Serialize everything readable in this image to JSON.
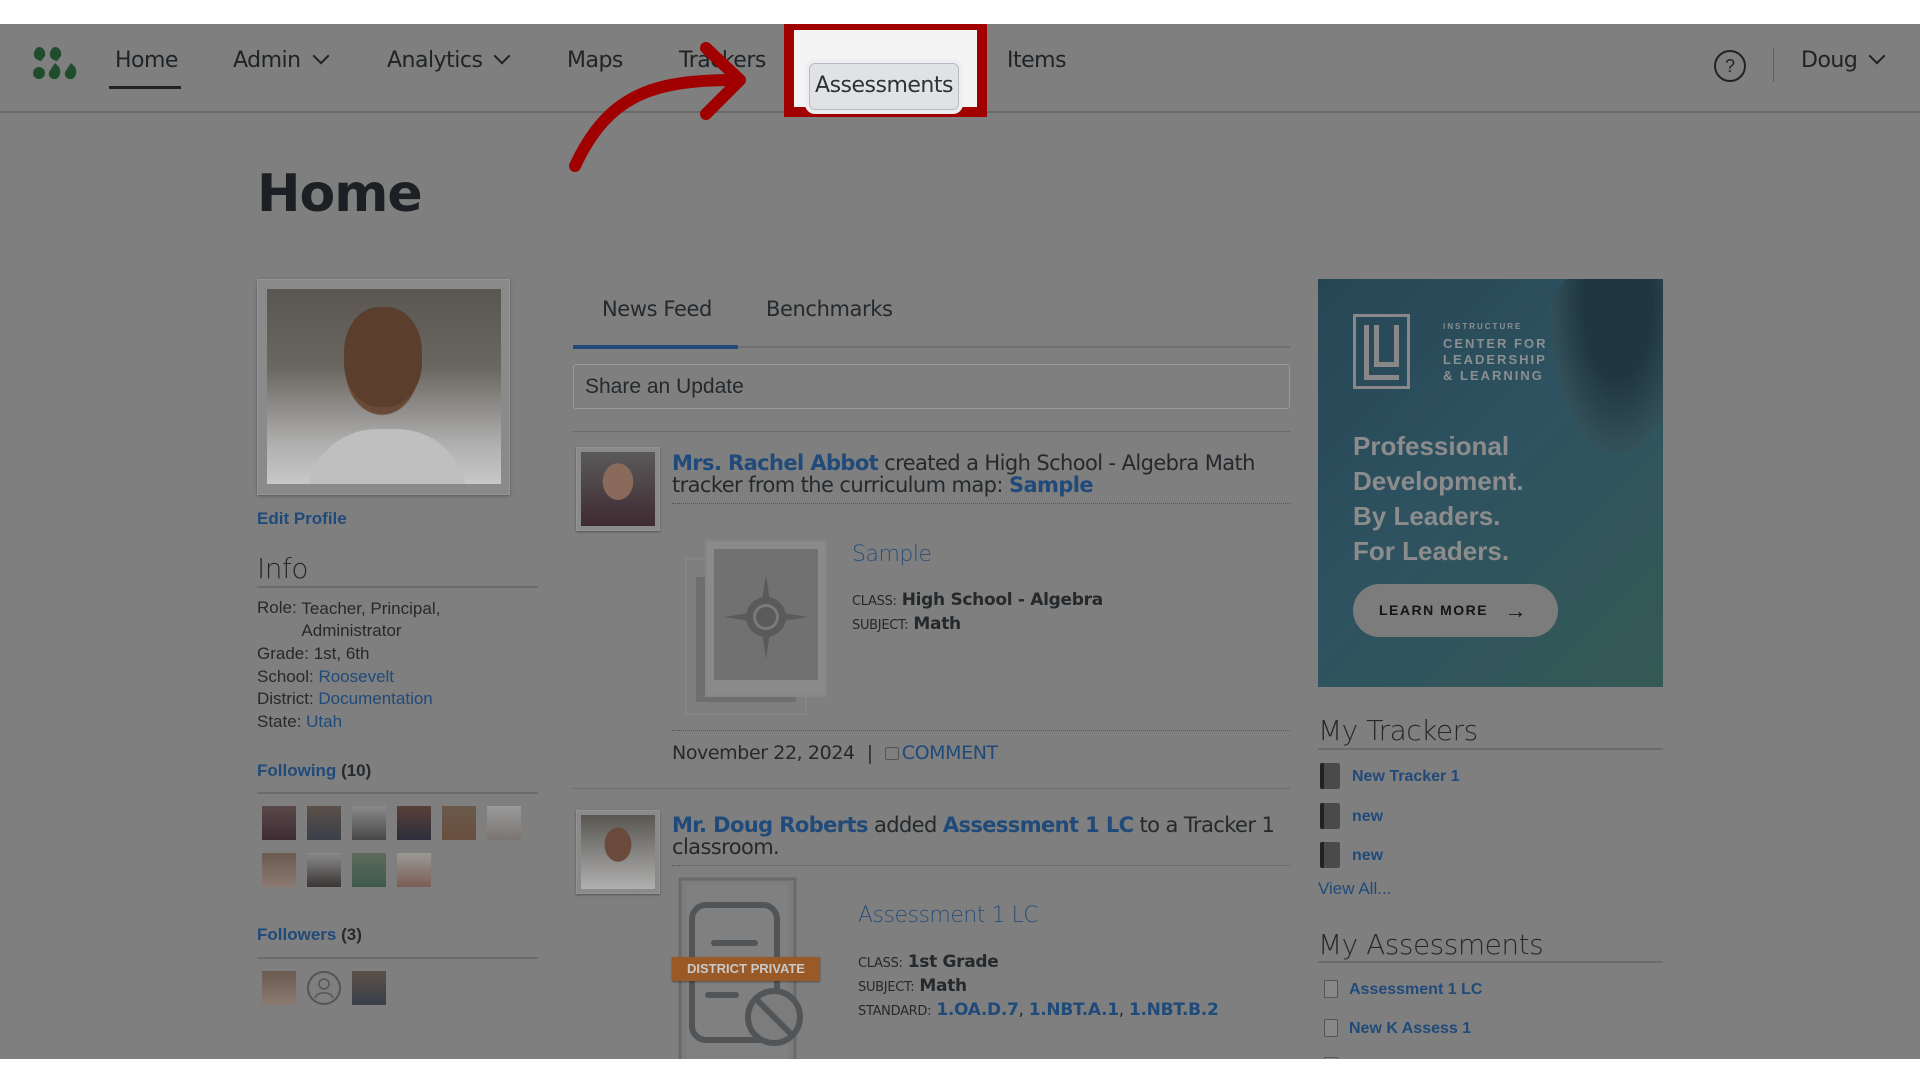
{
  "header": {
    "logo": "mastery-connect-logo",
    "nav": [
      {
        "label": "Home",
        "active": true,
        "dropdown": false
      },
      {
        "label": "Admin",
        "dropdown": true
      },
      {
        "label": "Analytics",
        "dropdown": true
      },
      {
        "label": "Maps",
        "dropdown": false
      },
      {
        "label": "Trackers",
        "dropdown": false
      },
      {
        "label": "Assessments",
        "dropdown": false,
        "highlighted": true
      },
      {
        "label": "Items",
        "dropdown": false
      }
    ],
    "help_icon": "?",
    "user_label": "Doug"
  },
  "annotation": {
    "color": "#a00000",
    "target": "Assessments"
  },
  "page": {
    "title": "Home"
  },
  "profile": {
    "edit_label": "Edit Profile",
    "info_heading": "Info",
    "role_label": "Role:",
    "role_value": "Teacher, Principal, Administrator",
    "grade_label": "Grade:",
    "grade_value": "1st, 6th",
    "school_label": "School:",
    "school_value": "Roosevelt",
    "district_label": "District:",
    "district_value": "Documentation",
    "state_label": "State:",
    "state_value": "Utah",
    "following_label": "Following",
    "following_count": "(10)",
    "followers_label": "Followers",
    "followers_count": "(3)"
  },
  "tabs": [
    {
      "label": "News Feed",
      "active": true
    },
    {
      "label": "Benchmarks",
      "active": false
    }
  ],
  "share": {
    "placeholder": "Share an Update"
  },
  "feed": [
    {
      "actor": "Mrs. Rachel Abbot",
      "text_1": " created a High School - Algebra Math tracker from the curriculum map: ",
      "link": "Sample",
      "card": {
        "title": "Sample",
        "class_label": "Class:",
        "class_value": "High School - Algebra",
        "subject_label": "Subject:",
        "subject_value": "Math"
      },
      "date": "November 22, 2024",
      "separator": "|",
      "comment_label": "COMMENT"
    },
    {
      "actor": "Mr. Doug Roberts",
      "text_1": " added ",
      "link": "Assessment 1 LC",
      "text_2": " to a Tracker 1 classroom.",
      "card": {
        "title": "Assessment 1 LC",
        "badge": "DISTRICT PRIVATE",
        "class_label": "Class:",
        "class_value": "1st Grade",
        "subject_label": "Subject:",
        "subject_value": "Math",
        "standard_label": "Standard:",
        "standards": [
          "1.OA.D.7",
          "1.NBT.A.1",
          "1.NBT.B.2"
        ]
      }
    }
  ],
  "ad": {
    "org_small": "INSTRUCTURE",
    "org_line1": "CENTER FOR",
    "org_line2": "LEADERSHIP",
    "org_line3": "& LEARNING",
    "headline_1": "Professional",
    "headline_2": "Development.",
    "headline_3": "By Leaders.",
    "headline_4": "For Leaders.",
    "button_label": "LEARN MORE",
    "button_arrow": "→"
  },
  "my_trackers": {
    "heading": "My Trackers",
    "items": [
      "New Tracker 1",
      "new",
      "new"
    ],
    "view_all": "View All..."
  },
  "my_assessments": {
    "heading": "My Assessments",
    "items": [
      "Assessment 1 LC",
      "New K Assess 1"
    ]
  }
}
